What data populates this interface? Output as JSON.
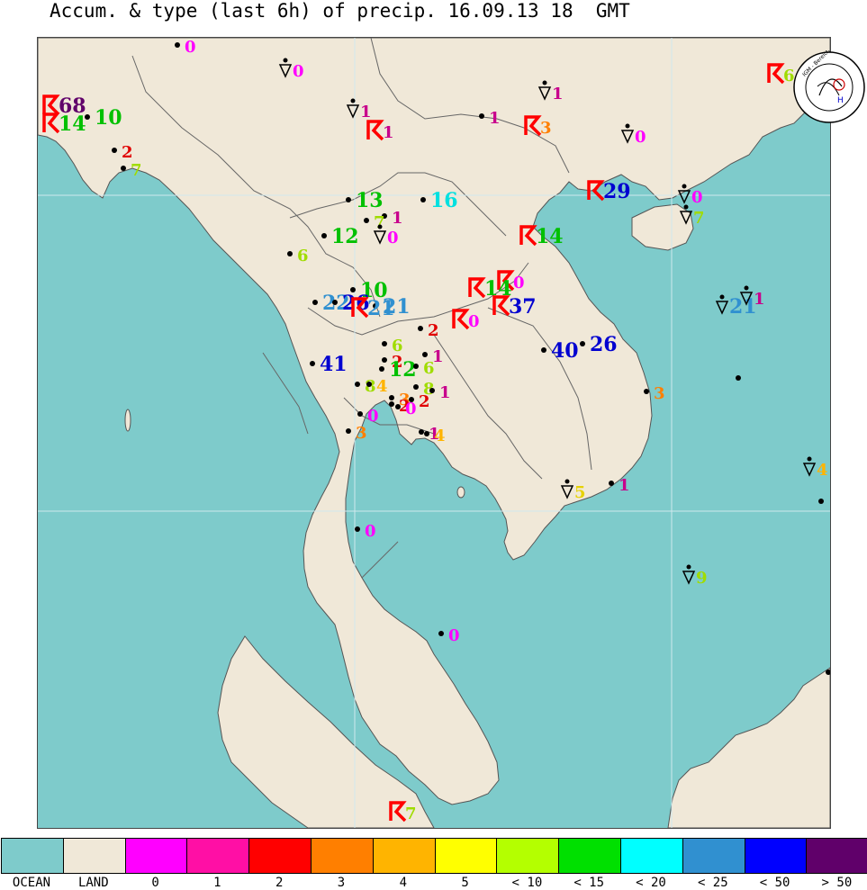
{
  "title": "Accum. & type (last 6h) of precip. 16.09.13 18  GMT",
  "colors": {
    "ocean": "#7ecbcb",
    "land": "#f0e8d8",
    "border": "#555555",
    "grid": "#cfe8ee",
    "rain_symbol": "#ff0000"
  },
  "logo": {
    "text": "IGM - Bereich Meteor. Universität zu Köln",
    "icon": "weather-chart-logo"
  },
  "legend": [
    {
      "label": "OCEAN",
      "color": "#7ecbcb"
    },
    {
      "label": "LAND",
      "color": "#f0e8d8"
    },
    {
      "label": "0",
      "color": "#ff00ff"
    },
    {
      "label": "1",
      "color": "#ff0fa5"
    },
    {
      "label": "2",
      "color": "#ff0000"
    },
    {
      "label": "3",
      "color": "#ff7f00"
    },
    {
      "label": "4",
      "color": "#ffb400"
    },
    {
      "label": "5",
      "color": "#ffff00"
    },
    {
      "label": "< 10",
      "color": "#b4ff00"
    },
    {
      "label": "< 15",
      "color": "#00e000"
    },
    {
      "label": "< 20",
      "color": "#00ffff"
    },
    {
      "label": "< 25",
      "color": "#3090d0"
    },
    {
      "label": "< 50",
      "color": "#0000ff"
    },
    {
      "label": "> 50",
      "color": "#60006a"
    }
  ],
  "stations": [
    {
      "v": "0",
      "t": "none"
    },
    {
      "v": "0",
      "t": "shower"
    },
    {
      "v": "68",
      "t": "thunder"
    },
    {
      "v": "14",
      "t": "thunder"
    },
    {
      "v": "10",
      "t": "none"
    },
    {
      "v": "1",
      "t": "shower"
    },
    {
      "v": "1",
      "t": "thunder"
    },
    {
      "v": "1",
      "t": "none"
    },
    {
      "v": "1",
      "t": "shower"
    },
    {
      "v": "3",
      "t": "thunder"
    },
    {
      "v": "0",
      "t": "shower"
    },
    {
      "v": "6",
      "t": "thunder"
    },
    {
      "v": "2",
      "t": "none"
    },
    {
      "v": "7",
      "t": "none"
    },
    {
      "v": "13",
      "t": "none"
    },
    {
      "v": "16",
      "t": "none"
    },
    {
      "v": "29",
      "t": "thunder"
    },
    {
      "v": "0",
      "t": "shower"
    },
    {
      "v": "7",
      "t": "shower"
    },
    {
      "v": "1",
      "t": "none"
    },
    {
      "v": "7",
      "t": "none"
    },
    {
      "v": "12",
      "t": "none"
    },
    {
      "v": "0",
      "t": "shower"
    },
    {
      "v": "6",
      "t": "none"
    },
    {
      "v": "14",
      "t": "thunder"
    },
    {
      "v": "10",
      "t": "none"
    },
    {
      "v": "0",
      "t": "thunder"
    },
    {
      "v": "14",
      "t": "thunder"
    },
    {
      "v": "22",
      "t": "none"
    },
    {
      "v": "26",
      "t": "none"
    },
    {
      "v": "21",
      "t": "none"
    },
    {
      "v": "21",
      "t": "thunder"
    },
    {
      "v": "37",
      "t": "thunder"
    },
    {
      "v": "21",
      "t": "shower"
    },
    {
      "v": "1",
      "t": "shower"
    },
    {
      "v": "0",
      "t": "thunder"
    },
    {
      "v": "2",
      "t": "none"
    },
    {
      "v": "6",
      "t": "none"
    },
    {
      "v": "41",
      "t": "none"
    },
    {
      "v": "2",
      "t": "none"
    },
    {
      "v": "1",
      "t": "none"
    },
    {
      "v": "40",
      "t": "none"
    },
    {
      "v": "26",
      "t": "none"
    },
    {
      "v": "12",
      "t": "none"
    },
    {
      "v": "6",
      "t": "none"
    },
    {
      "v": "8",
      "t": "none"
    },
    {
      "v": "4",
      "t": "none"
    },
    {
      "v": "8",
      "t": "none"
    },
    {
      "v": "3",
      "t": "none"
    },
    {
      "v": "2",
      "t": "none"
    },
    {
      "v": "0",
      "t": "none"
    },
    {
      "v": "2",
      "t": "none"
    },
    {
      "v": "1",
      "t": "none"
    },
    {
      "v": "0",
      "t": "none"
    },
    {
      "v": "3",
      "t": "none"
    },
    {
      "v": "1",
      "t": "none"
    },
    {
      "v": "4",
      "t": "none"
    },
    {
      "v": "3",
      "t": "none"
    },
    {
      "v": "4",
      "t": "shower"
    },
    {
      "v": "5",
      "t": "shower"
    },
    {
      "v": "1",
      "t": "none"
    },
    {
      "v": "1",
      "t": "none"
    },
    {
      "v": "0",
      "t": "none"
    },
    {
      "v": "9",
      "t": "shower"
    },
    {
      "v": "0",
      "t": "none"
    },
    {
      "v": "7",
      "t": "thunder"
    },
    {
      "v": "",
      "t": "none"
    },
    {
      "v": "",
      "t": "none"
    }
  ]
}
